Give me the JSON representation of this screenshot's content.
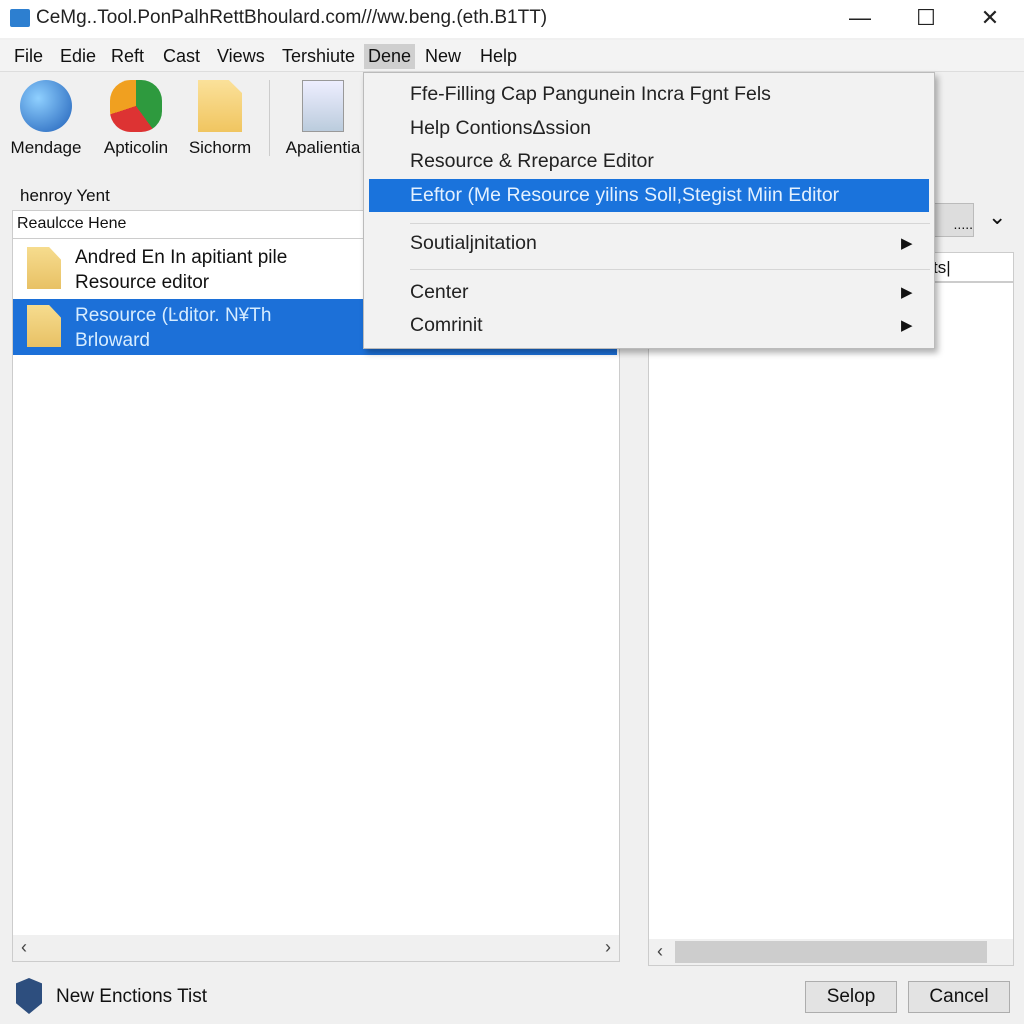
{
  "window": {
    "title": "CeMg..Tool.PonPalhRettBhoulard.com///ww.beng.(eth.B1TT)",
    "minimize": "—",
    "maximize": "☐",
    "close": "✕"
  },
  "menubar": [
    "File",
    "Edie",
    "Reft",
    "Cast",
    "Views",
    "Tershiute",
    "Dene",
    "New",
    "Help"
  ],
  "toolbar": [
    {
      "label": "Mendage",
      "icon": "globe-icon"
    },
    {
      "label": "Apticolin",
      "icon": "puzzle-icon"
    },
    {
      "label": "Sichorm",
      "icon": "document-icon"
    },
    {
      "label": "Apalientia",
      "icon": "form-icon"
    }
  ],
  "left": {
    "group_label": "henroy Yent",
    "header": "Reaulcce Hene",
    "items": [
      {
        "line1": "Andred En In apitiant pile",
        "line2": "Resource editor",
        "selected": false
      },
      {
        "line1": "Resource (Ŀditor. N¥Th",
        "line2": "Brloward",
        "selected": true
      }
    ],
    "scroll_left": "‹",
    "scroll_right": "›"
  },
  "right": {
    "button": ".....",
    "chevron": "⌄",
    "input_value": "ts|",
    "scroll_left": "‹"
  },
  "dropdown": {
    "items": [
      "Ffe-Filling Cap Pangunein Incra Fgnt Fels",
      "Help ContionsΔssion",
      "Resource & Rreparce Editor",
      "Eeftor (Me Resource yilins Soll,Stegist Miin Editor",
      "Soutialjnitation",
      "Center",
      "Comrinit"
    ],
    "highlighted": 3,
    "submenu_arrow": "▶"
  },
  "footer": {
    "status": "New Enctions Tist",
    "ok": "Selop",
    "cancel": "Cancel"
  },
  "colors": {
    "selection": "#1a73dc"
  }
}
